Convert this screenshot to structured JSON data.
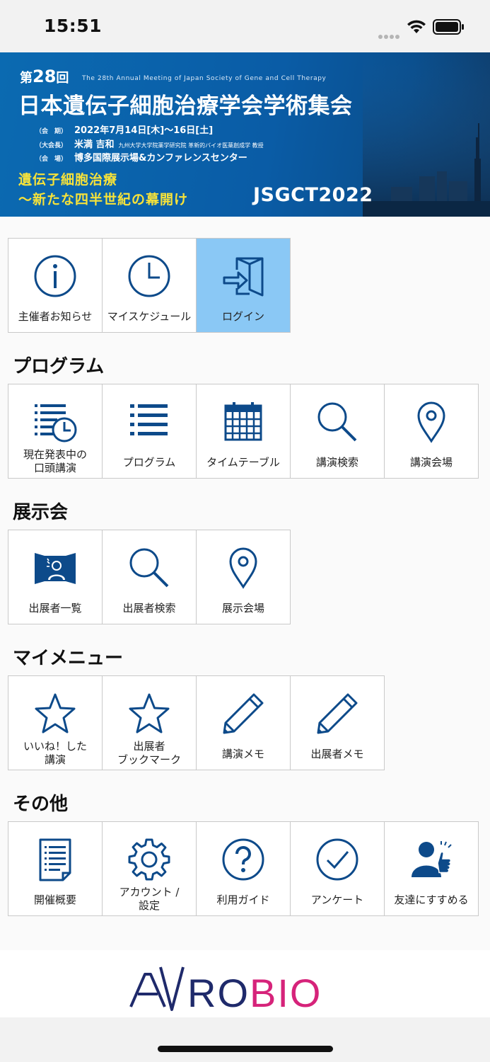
{
  "status_bar": {
    "time": "15:51"
  },
  "banner": {
    "edition_prefix": "第",
    "edition_number": "28",
    "edition_suffix": "回",
    "title_en": "The 28th Annual Meeting of Japan Society of Gene and Cell Therapy",
    "title": "日本遺伝子細胞治療学会学術集会",
    "date_tag": "（会　期）",
    "date": "2022年7月14日[木]～16日[土]",
    "president_tag": "（大会長）",
    "president": "米満 吉和",
    "president_affiliation": "九州大学大学院薬学研究院 革新的バイオ医薬創成学 教授",
    "venue_tag": "（会　場）",
    "venue": "博多国際展示場&カンファレンスセンター",
    "theme_line1": "遺伝子細胞治療",
    "theme_line2": "～新たな四半世紀の幕開け",
    "code": "JSGCT2022"
  },
  "top_menu": [
    {
      "label": "主催者お知らせ",
      "icon": "info-icon"
    },
    {
      "label": "マイスケジュール",
      "icon": "clock-icon"
    },
    {
      "label": "ログイン",
      "icon": "login-icon",
      "active": true
    }
  ],
  "sections": {
    "program": {
      "title": "プログラム",
      "items": [
        {
          "label": "現在発表中の\n口頭講演",
          "icon": "list-clock-icon"
        },
        {
          "label": "プログラム",
          "icon": "list-icon"
        },
        {
          "label": "タイムテーブル",
          "icon": "calendar-icon"
        },
        {
          "label": "講演検索",
          "icon": "search-icon"
        },
        {
          "label": "講演会場",
          "icon": "map-pin-icon"
        }
      ]
    },
    "exhibition": {
      "title": "展示会",
      "items": [
        {
          "label": "出展者一覧",
          "icon": "exhibitor-booth-icon"
        },
        {
          "label": "出展者検索",
          "icon": "search-icon"
        },
        {
          "label": "展示会場",
          "icon": "map-pin-icon"
        }
      ]
    },
    "my_menu": {
      "title": "マイメニュー",
      "items": [
        {
          "label": "いいね！した\n講演",
          "icon": "star-icon"
        },
        {
          "label": "出展者\nブックマーク",
          "icon": "star-icon"
        },
        {
          "label": "講演メモ",
          "icon": "pencil-icon"
        },
        {
          "label": "出展者メモ",
          "icon": "pencil-icon"
        }
      ]
    },
    "other": {
      "title": "その他",
      "items": [
        {
          "label": "開催概要",
          "icon": "document-icon"
        },
        {
          "label": "アカウント /\n設定",
          "icon": "gear-icon"
        },
        {
          "label": "利用ガイド",
          "icon": "help-icon"
        },
        {
          "label": "アンケート",
          "icon": "check-circle-icon"
        },
        {
          "label": "友達にすすめる",
          "icon": "thumbs-up-person-icon"
        }
      ]
    }
  },
  "sponsor": {
    "name": "AVROBIO",
    "colors": {
      "navy": "#1f2a6b",
      "magenta": "#d6237a"
    }
  },
  "theme": {
    "icon_color": "#0d4a8a",
    "active_tile": "#8ac8f5",
    "banner_blue": "#0a5ca6",
    "banner_yellow": "#f6e23a"
  }
}
